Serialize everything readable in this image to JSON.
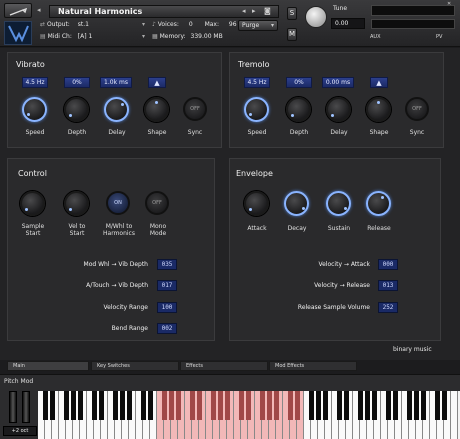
{
  "header": {
    "instrument_name": "Natural Harmonics",
    "output_label": "Output:",
    "output_value": "st.1",
    "midi_label": "Midi Ch:",
    "midi_value": "[A] 1",
    "voices_label": "Voices:",
    "voices_value": "0",
    "max_label": "Max:",
    "max_value": "96",
    "purge_label": "Purge",
    "memory_label": "Memory:",
    "memory_value": "339.00 MB",
    "solo_label": "S",
    "mute_label": "M",
    "tune_label": "Tune",
    "tune_value": "0.00",
    "pv_label": "PV",
    "aux_label": "AUX"
  },
  "vibrato": {
    "title": "Vibrato",
    "speed_value": "4.5 Hz",
    "depth_value": "0%",
    "delay_value": "1.0k ms",
    "knob_labels": [
      "Speed",
      "Depth",
      "Delay",
      "Shape",
      "Sync"
    ],
    "sync_state": "OFF"
  },
  "tremolo": {
    "title": "Tremolo",
    "speed_value": "4.5 Hz",
    "depth_value": "0%",
    "delay_value": "0.00 ms",
    "knob_labels": [
      "Speed",
      "Depth",
      "Delay",
      "Shape",
      "Sync"
    ],
    "sync_state": "OFF"
  },
  "control": {
    "title": "Control",
    "labels": [
      "Sample\nStart",
      "Vel to\nStart",
      "M/Whl to\nHarmonics",
      "Mono\nMode"
    ],
    "harmonics_state": "ON",
    "mono_state": "OFF",
    "rows": [
      {
        "label": "Mod Whl → Vib Depth",
        "value": "035"
      },
      {
        "label": "A/Touch → Vib Depth",
        "value": "017"
      },
      {
        "label": "Velocity Range",
        "value": "100"
      },
      {
        "label": "Bend Range",
        "value": "002"
      }
    ]
  },
  "envelope": {
    "title": "Envelope",
    "knob_labels": [
      "Attack",
      "Decay",
      "Sustain",
      "Release"
    ],
    "rows": [
      {
        "label": "Velocity → Attack",
        "value": "000"
      },
      {
        "label": "Velocity → Release",
        "value": "013"
      },
      {
        "label": "Release Sample Volume",
        "value": "252"
      }
    ]
  },
  "brand": "binary music",
  "tabs": [
    "Main",
    "Key Switches",
    "Effects",
    "Mod Effects"
  ],
  "keyboard": {
    "pitch_mod_label": "Pitch Mod",
    "octave_value": "+2 oct"
  },
  "colors": {
    "accent": "#8ab4ff",
    "value_box": "#1c2a66",
    "key_range": "#f2b8b8"
  }
}
